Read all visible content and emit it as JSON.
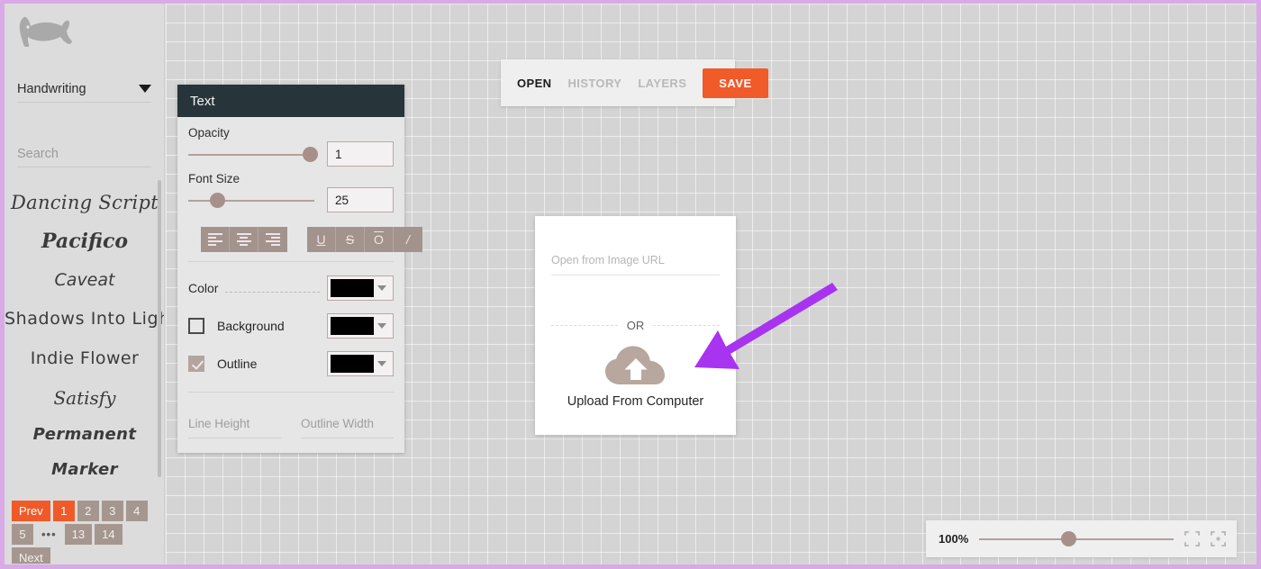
{
  "app": {
    "logo_icon": "bear-logo-icon",
    "canvas_background": "#d4d4d4",
    "accent_orange": "#f15a29",
    "annotation_arrow_color": "#a833f0",
    "border_color": "#d9a9e8"
  },
  "sidebar": {
    "font_category": {
      "label": "Handwriting",
      "caret_icon": "chevron-down-icon"
    },
    "search": {
      "placeholder": "Search",
      "value": ""
    },
    "fonts": [
      {
        "name": "Dancing Script",
        "style_class": "f-dancing"
      },
      {
        "name": "Pacifico",
        "style_class": "f-pacifico"
      },
      {
        "name": "Caveat",
        "style_class": "f-caveat"
      },
      {
        "name": "Shadows Into Light",
        "style_class": "f-shadows"
      },
      {
        "name": "Indie Flower",
        "style_class": "f-indie"
      },
      {
        "name": "Satisfy",
        "style_class": "f-satisfy"
      },
      {
        "name": "Permanent",
        "style_class": "f-permanent"
      },
      {
        "name": "Marker",
        "style_class": "f-permanent second"
      }
    ],
    "pagination": {
      "prev_label": "Prev",
      "next_label": "Next",
      "ellipsis": "•••",
      "pages": [
        "1",
        "2",
        "3",
        "4",
        "5",
        "13",
        "14"
      ],
      "active_page": "1"
    }
  },
  "text_panel": {
    "title": "Text",
    "opacity": {
      "label": "Opacity",
      "value": "1",
      "thumb_percent": 93
    },
    "font_size": {
      "label": "Font Size",
      "value": "25",
      "thumb_percent": 20
    },
    "align_buttons": [
      {
        "name": "align-left",
        "icon": "align-left-icon"
      },
      {
        "name": "align-center",
        "icon": "align-center-icon"
      },
      {
        "name": "align-right",
        "icon": "align-right-icon"
      }
    ],
    "style_buttons": [
      {
        "label": "U",
        "name": "underline",
        "icon": "underline-icon"
      },
      {
        "label": "S",
        "name": "strikethrough",
        "icon": "strikethrough-icon"
      },
      {
        "label": "O",
        "name": "overline",
        "icon": "overline-icon"
      },
      {
        "label": "/",
        "name": "italic",
        "icon": "italic-icon"
      }
    ],
    "color": {
      "label": "Color",
      "swatch_hex": "#000000"
    },
    "background": {
      "label": "Background",
      "checked": false,
      "swatch_hex": "#000000"
    },
    "outline": {
      "label": "Outline",
      "checked": true,
      "swatch_hex": "#000000"
    },
    "line_height": {
      "placeholder": "Line Height",
      "value": ""
    },
    "outline_width": {
      "placeholder": "Outline Width",
      "value": ""
    }
  },
  "toolbar": {
    "tabs": [
      {
        "label": "OPEN",
        "active": true
      },
      {
        "label": "HISTORY",
        "active": false
      },
      {
        "label": "LAYERS",
        "active": false
      }
    ],
    "save_label": "SAVE"
  },
  "open_dialog": {
    "url_input": {
      "placeholder": "Open from Image URL",
      "value": ""
    },
    "or_label": "OR",
    "upload": {
      "icon": "cloud-upload-icon",
      "label": "Upload From Computer"
    }
  },
  "zoom_bar": {
    "level": "100%",
    "slider_percent": 42,
    "fullscreen_icon": "fullscreen-expand-icon",
    "fit_icon": "fit-to-center-icon"
  }
}
